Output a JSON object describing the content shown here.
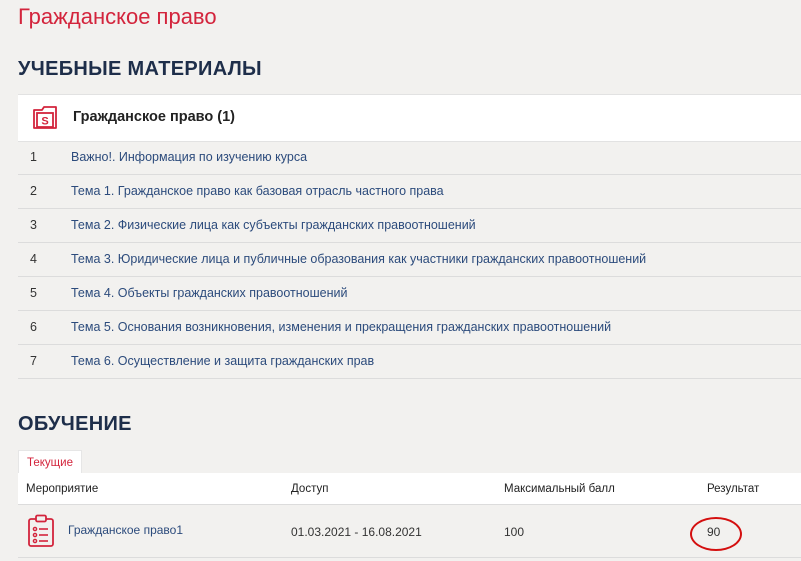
{
  "page": {
    "title": "Гражданское право"
  },
  "materials": {
    "section_title": "УЧЕБНЫЕ МАТЕРИАЛЫ",
    "course": {
      "icon": "document-s-icon",
      "title": "Гражданское право (1)"
    },
    "topics": [
      {
        "num": "1",
        "label": "Важно!. Информация по изучению курса"
      },
      {
        "num": "2",
        "label": "Тема 1. Гражданское право как базовая отрасль частного права"
      },
      {
        "num": "3",
        "label": "Тема 2. Физические лица как субъекты гражданских правоотношений"
      },
      {
        "num": "4",
        "label": "Тема 3. Юридические лица и публичные образования как участники гражданских правоотношений"
      },
      {
        "num": "5",
        "label": "Тема 4. Объекты гражданских правоотношений"
      },
      {
        "num": "6",
        "label": "Тема 5. Основания возникновения, изменения и прекращения гражданских правоотношений"
      },
      {
        "num": "7",
        "label": "Тема 6. Осуществление и защита гражданских прав"
      }
    ]
  },
  "learning": {
    "section_title": "ОБУЧЕНИЕ",
    "tab_current": "Текущие",
    "columns": {
      "event": "Мероприятие",
      "access": "Доступ",
      "max_score": "Максимальный балл",
      "result": "Результат"
    },
    "rows": [
      {
        "icon": "clipboard-list-icon",
        "event": "Гражданское право1",
        "access": "01.03.2021 - 16.08.2021",
        "max_score": "100",
        "result": "90"
      }
    ]
  },
  "colors": {
    "accent": "#d3243c",
    "heading": "#1e2e4a",
    "link": "#2c4b7c",
    "highlight": "#d40f0f"
  }
}
